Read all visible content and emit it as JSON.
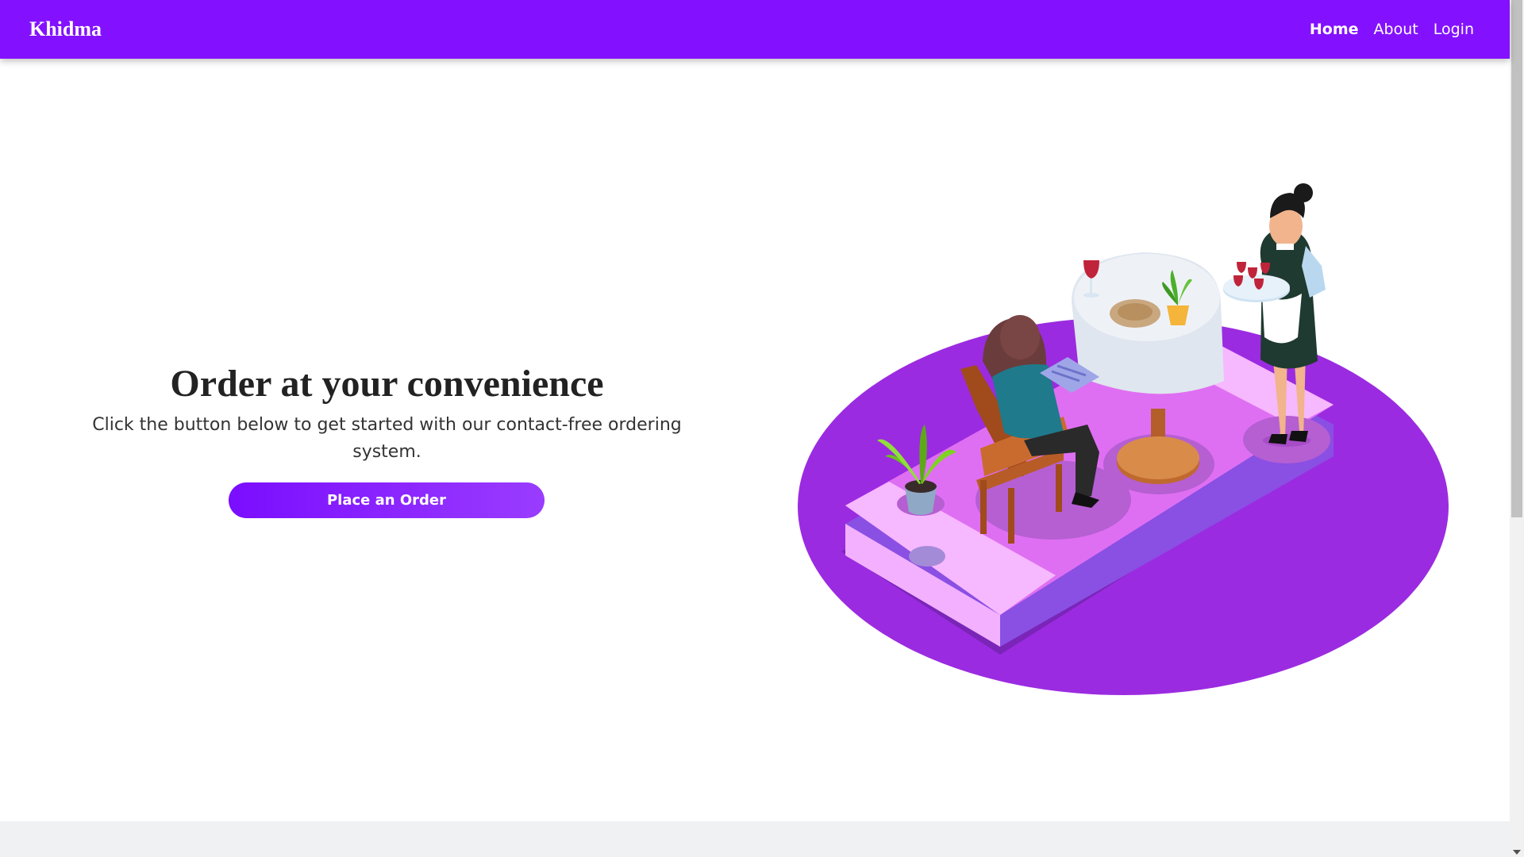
{
  "nav": {
    "brand": "Khidma",
    "links": [
      {
        "label": "Home",
        "active": true
      },
      {
        "label": "About",
        "active": false
      },
      {
        "label": "Login",
        "active": false
      }
    ]
  },
  "hero": {
    "title": "Order at your convenience",
    "subtitle": "Click the button below to get started with our contact-free ordering system.",
    "cta_label": "Place an Order"
  },
  "colors": {
    "navbar": "#8311ff",
    "button": "#8a1fff",
    "illustration_platform": "#9b2be0"
  },
  "icons": {
    "illustration": "restaurant-waitress-isometric-illustration"
  }
}
